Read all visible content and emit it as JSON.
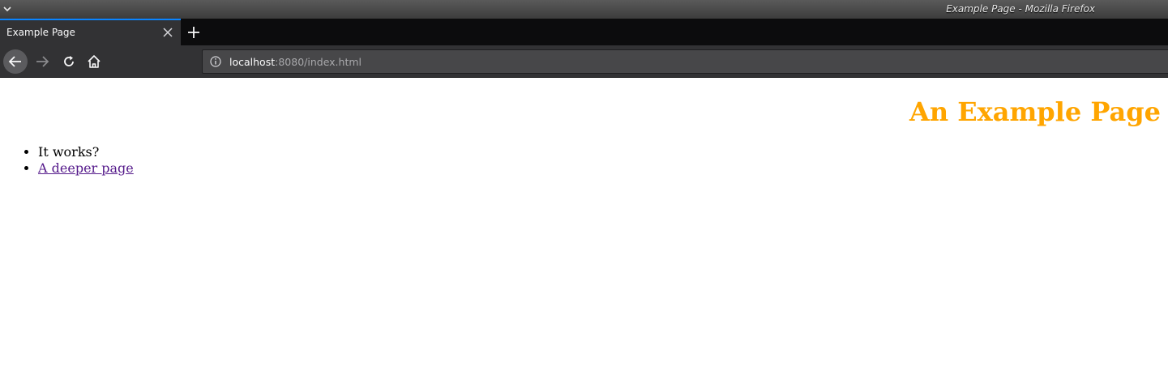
{
  "window": {
    "title": "Example Page - Mozilla Firefox"
  },
  "tabs": [
    {
      "label": "Example Page",
      "active": true
    }
  ],
  "navbar": {
    "url_host": "localhost",
    "url_rest": ":8080/index.html"
  },
  "page": {
    "heading": "An Example Page",
    "heading_color": "#ffa500",
    "list_items": [
      {
        "text": "It works?"
      },
      {
        "text": "A deeper page",
        "link_color": "#551a8b"
      }
    ]
  },
  "colors": {
    "tab_accent": "#0a84ff",
    "chrome_dark": "#0c0c0d",
    "chrome_mid": "#323234",
    "urlbar_bg": "#474749"
  },
  "icons": {
    "window_menu": "chevron-down-icon",
    "tab_close": "close-icon",
    "new_tab": "plus-icon",
    "back": "arrow-left-icon",
    "forward": "arrow-right-icon",
    "reload": "reload-icon",
    "home": "home-icon",
    "site_info": "info-icon"
  }
}
